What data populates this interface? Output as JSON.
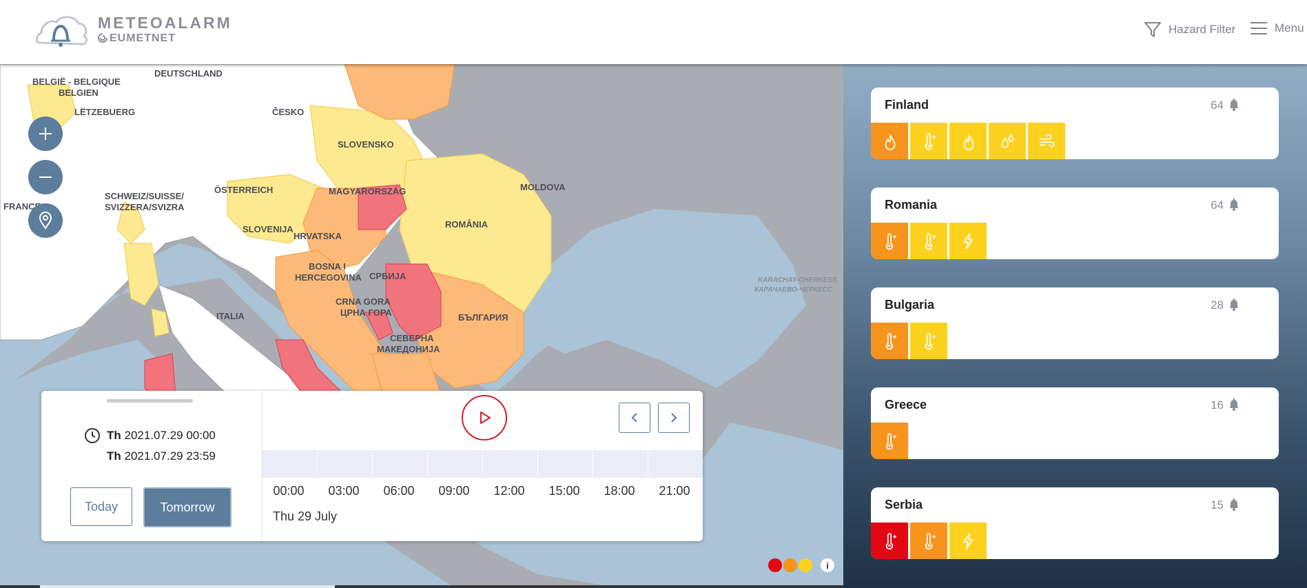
{
  "header": {
    "logo_title": "METEOALARM",
    "logo_subtitle": "EUMETNET",
    "hazard_filter_label": "Hazard Filter",
    "menu_label": "Menu"
  },
  "map": {
    "country_labels": [
      "BELGIË - BELGIQUE",
      "BELGIEN",
      "DEUTSCHLAND",
      "LËTZEBUERG",
      "ČESKO",
      "SLOVENSKO",
      "FRANCE",
      "SCHWEIZ/SUISSE/",
      "SVIZZERA/SVIZRA",
      "ÖSTERREICH",
      "MAGYARORSZÁG",
      "MOLDOVA",
      "ROMÂNIA",
      "SLOVENIJA",
      "HRVATSKA",
      "BOSNA I",
      "HERCEGOVINA",
      "СРБИЈА",
      "CRNA GORA",
      "ЦРНА ГОРА",
      "ITALIA",
      "БЪЛГАРИЯ",
      "СЕВЕРНА",
      "МАКЕДОНИЈА",
      "KARACHAY-CHERKESS",
      "КАРАЧАЕВО-ЧЕРКЕСС"
    ],
    "colors": {
      "sea": "#aac3d6",
      "land_nodata": "#a9adb3",
      "land_green": "#ffffff",
      "yellow": "#fde98f",
      "orange": "#fcb978",
      "red": "#f1747d"
    }
  },
  "timeline": {
    "start_day": "Th",
    "start_time": "2021.07.29 00:00",
    "end_day": "Th",
    "end_time": "2021.07.29 23:59",
    "today_label": "Today",
    "tomorrow_label": "Tomorrow",
    "hours": [
      "00:00",
      "03:00",
      "06:00",
      "09:00",
      "12:00",
      "15:00",
      "18:00",
      "21:00"
    ],
    "day_label": "Thu 29 July"
  },
  "legend": {
    "colors": [
      "#e30613",
      "#f7941d",
      "#fcd21f"
    ],
    "info_label": "i"
  },
  "countries": [
    {
      "name": "Finland",
      "count": "64",
      "hazards": [
        {
          "level": "orange",
          "icon": "fire-icon"
        },
        {
          "level": "yellow",
          "icon": "thermometer-high-icon"
        },
        {
          "level": "yellow",
          "icon": "fire-icon"
        },
        {
          "level": "yellow",
          "icon": "rain-drops-icon"
        },
        {
          "level": "yellow",
          "icon": "wind-icon"
        }
      ]
    },
    {
      "name": "Romania",
      "count": "64",
      "hazards": [
        {
          "level": "orange",
          "icon": "thermometer-high-icon"
        },
        {
          "level": "yellow",
          "icon": "thermometer-high-icon"
        },
        {
          "level": "yellow",
          "icon": "thunderstorm-icon"
        }
      ]
    },
    {
      "name": "Bulgaria",
      "count": "28",
      "hazards": [
        {
          "level": "orange",
          "icon": "thermometer-high-icon"
        },
        {
          "level": "yellow",
          "icon": "thermometer-high-icon"
        }
      ]
    },
    {
      "name": "Greece",
      "count": "16",
      "hazards": [
        {
          "level": "orange",
          "icon": "thermometer-high-icon"
        }
      ]
    },
    {
      "name": "Serbia",
      "count": "15",
      "hazards": [
        {
          "level": "red",
          "icon": "thermometer-high-icon"
        },
        {
          "level": "orange",
          "icon": "thermometer-high-icon"
        },
        {
          "level": "yellow",
          "icon": "thunderstorm-icon"
        }
      ]
    }
  ]
}
